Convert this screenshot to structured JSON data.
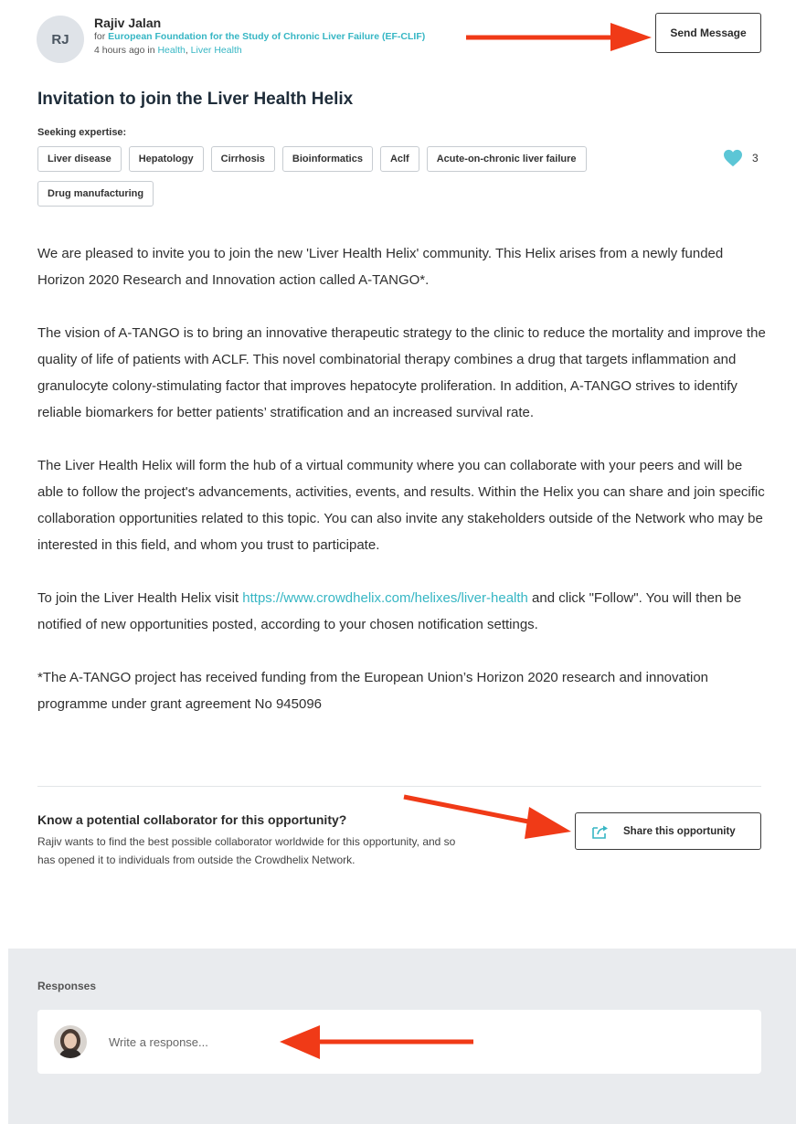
{
  "author": {
    "initials": "RJ",
    "name": "Rajiv Jalan",
    "for_prefix": "for ",
    "organization": "European Foundation for the Study of Chronic Liver Failure (EF-CLIF)",
    "time_text": "4 hours ago in ",
    "category_1": "Health",
    "separator": ", ",
    "category_2": "Liver Health"
  },
  "send_message_label": "Send Message",
  "post": {
    "title": "Invitation to join the Liver Health Helix",
    "seeking_label": "Seeking expertise:",
    "tags": [
      "Liver disease",
      "Hepatology",
      "Cirrhosis",
      "Bioinformatics",
      "Aclf",
      "Acute-on-chronic liver failure",
      "Drug manufacturing"
    ],
    "like_count": "3",
    "paragraph_1": "We are pleased to invite you to join the new 'Liver Health Helix' community. This Helix arises from a newly funded Horizon 2020 Research and Innovation action called A-TANGO*.",
    "paragraph_2": "The vision of A-TANGO is to bring an innovative therapeutic strategy to the clinic to reduce the mortality and improve the quality of life of patients with ACLF. This novel combinatorial therapy combines a drug that targets inflammation and granulocyte colony-stimulating factor that improves hepatocyte proliferation. In addition, A-TANGO strives to identify reliable biomarkers for better patients’ stratification and an increased survival rate.",
    "paragraph_3": "The Liver Health Helix will form the hub of a virtual community where you can collaborate with your peers and will be able to follow the project's advancements, activities, events, and results. Within the Helix you can share and join specific collaboration opportunities related to this topic. You can also invite any stakeholders outside of the Network who may be interested in this field, and whom you trust to participate.",
    "paragraph_4_before": "To join the Liver Health Helix visit ",
    "paragraph_4_link": "https://www.crowdhelix.com/helixes/liver-health",
    "paragraph_4_after": " and click \"Follow\". You will then be notified of new opportunities posted, according to your chosen notification settings.",
    "paragraph_5": "*The A-TANGO project has received funding from the European Union’s Horizon 2020 research and innovation programme under grant agreement No 945096"
  },
  "share": {
    "title": "Know a potential collaborator for this opportunity?",
    "description": "Rajiv wants to find the best possible collaborator worldwide for this opportunity, and so has opened it to individuals from outside the Crowdhelix Network.",
    "button_label": "Share this opportunity"
  },
  "responses": {
    "label": "Responses",
    "placeholder": "Write a response..."
  },
  "colors": {
    "accent": "#36b6c4",
    "heart": "#5cc6d6",
    "annotation_arrow": "#f03a17",
    "responses_bg": "#e9ebee"
  },
  "icons": [
    "heart-icon",
    "share-icon",
    "user-avatar"
  ]
}
